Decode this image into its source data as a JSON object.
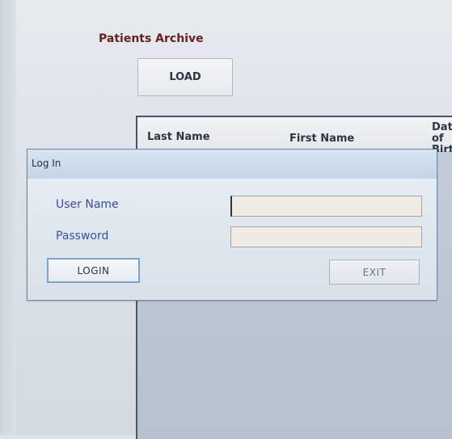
{
  "archive": {
    "title": "Patients Archive",
    "load_label": "LOAD"
  },
  "table": {
    "columns": [
      "Last Name",
      "First Name",
      "Date of\nBirth"
    ]
  },
  "login_dialog": {
    "title": "Log In",
    "username_label": "User Name",
    "username_value": "",
    "password_label": "Password",
    "password_value": "",
    "login_label": "LOGIN",
    "exit_label": "EXIT"
  },
  "colors": {
    "title_text": "#6b2020",
    "label_text": "#3a4f9a",
    "dialog_border": "#6d85a3",
    "input_bg": "#f1ece3",
    "table_bg": "#bcc6d2"
  }
}
